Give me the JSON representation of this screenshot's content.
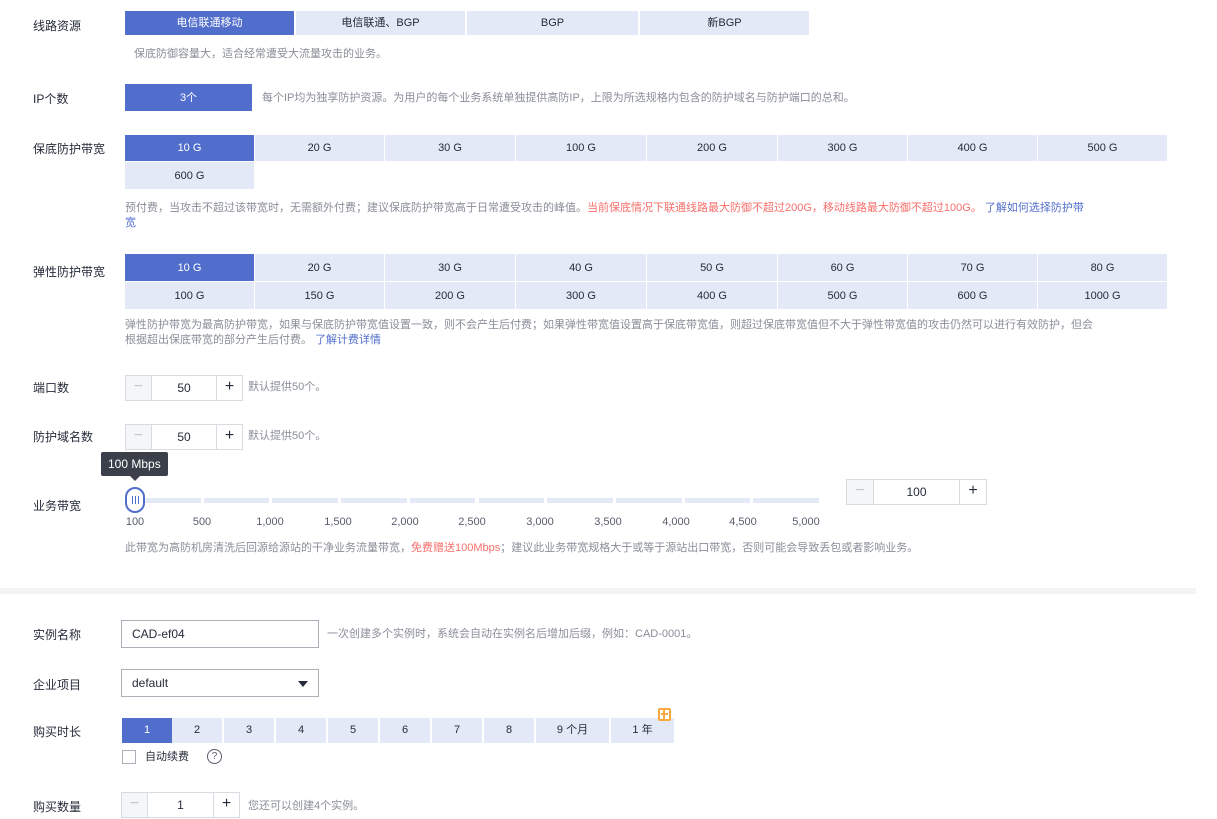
{
  "line": {
    "label": "线路资源",
    "options": [
      "电信联通移动",
      "电信联通、BGP",
      "BGP",
      "新BGP"
    ],
    "hint": "保底防御容量大，适合经常遭受大流量攻击的业务。"
  },
  "ip": {
    "label": "IP个数",
    "value": "3个",
    "hint": "每个IP均为独享防护资源。为用户的每个业务系统单独提供高防IP，上限为所选规格内包含的防护域名与防护端口的总和。"
  },
  "base": {
    "label": "保底防护带宽",
    "options": [
      "10 G",
      "20 G",
      "30 G",
      "100 G",
      "200 G",
      "300 G",
      "400 G",
      "500 G",
      "600 G"
    ],
    "hint_a": "预付费，当攻击不超过该带宽时，无需额外付费；建议保底防护带宽高于日常遭受攻击的峰值。",
    "hint_red": "当前保底情况下联通线路最大防御不超过200G，移动线路最大防御不超过100G。",
    "hint_link_1": "了解如何选择防护带",
    "hint_link_2": "宽"
  },
  "elastic": {
    "label": "弹性防护带宽",
    "row1": [
      "10 G",
      "20 G",
      "30 G",
      "40 G",
      "50 G",
      "60 G",
      "70 G",
      "80 G"
    ],
    "row2": [
      "100 G",
      "150 G",
      "200 G",
      "300 G",
      "400 G",
      "500 G",
      "600 G",
      "1000 G"
    ],
    "hint_line1": "弹性防护带宽为最高防护带宽，如果与保底防护带宽值设置一致，则不会产生后付费；如果弹性带宽值设置高于保底带宽值，则超过保底带宽值但不大于弹性带宽值的攻击仍然可以进行有效防护，但会",
    "hint_line2": "根据超出保底带宽的部分产生后付费。",
    "hint_link": "了解计费详情"
  },
  "ports": {
    "label": "端口数",
    "value": "50",
    "hint": "默认提供50个。"
  },
  "domains": {
    "label": "防护域名数",
    "value": "50",
    "hint": "默认提供50个。"
  },
  "bandwidth": {
    "label": "业务带宽",
    "tooltip": "100 Mbps",
    "value": "100",
    "value_fraction": 0.0,
    "ticks": [
      "100",
      "500",
      "1,000",
      "1,500",
      "2,000",
      "2,500",
      "3,000",
      "3,500",
      "4,000",
      "4,500",
      "5,000"
    ],
    "hint_a": "此带宽为高防机房清洗后回源给源站的干净业务流量带宽，",
    "hint_red": "免费赠送100Mbps",
    "hint_b": "；建议此业务带宽规格大于或等于源站出口带宽，否则可能会导致丢包或者影响业务。"
  },
  "instance": {
    "label": "实例名称",
    "value": "CAD-ef04",
    "hint": "一次创建多个实例时，系统会自动在实例名后增加后缀，例如：CAD-0001。"
  },
  "project": {
    "label": "企业项目",
    "value": "default"
  },
  "duration": {
    "label": "购买时长",
    "options": [
      "1",
      "2",
      "3",
      "4",
      "5",
      "6",
      "7",
      "8",
      "9 个月",
      "1 年"
    ],
    "auto_renew": "自动续费"
  },
  "quantity": {
    "label": "购买数量",
    "value": "1",
    "hint": "您还可以创建4个实例。"
  },
  "colors": {
    "accent": "#526ecc",
    "option_bg": "#e4e9f7",
    "warning": "#f66f6a",
    "badge": "#f8a83c"
  },
  "icons": {
    "minus": "minus-icon",
    "plus": "plus-icon",
    "help": "help-circle-icon",
    "dropdown": "caret-down-icon",
    "gift": "gift-icon"
  }
}
